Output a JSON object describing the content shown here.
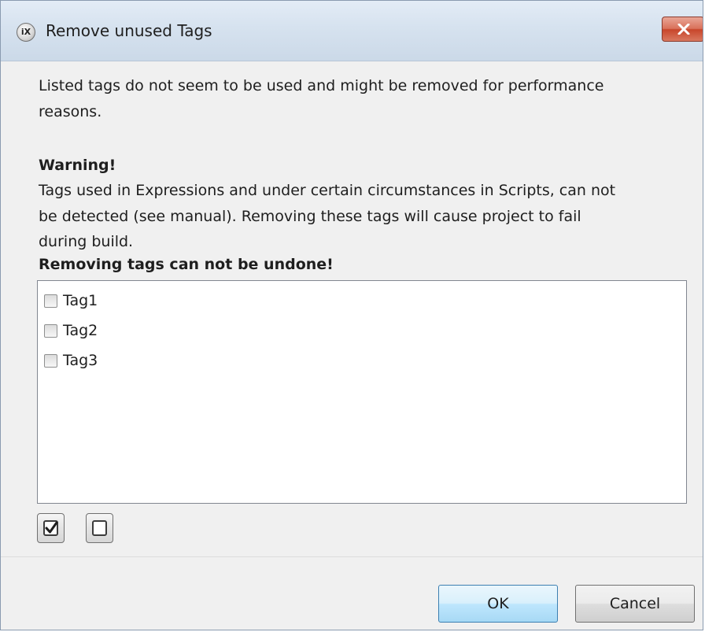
{
  "window": {
    "title": "Remove unused Tags",
    "icon_text": "iX"
  },
  "message": {
    "line1": "Listed tags do not seem to be used and might be removed for performance",
    "line2": "reasons."
  },
  "warning": {
    "heading": "Warning!",
    "line1": "Tags used in Expressions and under certain circumstances in Scripts, can not",
    "line2": "be detected (see manual). Removing these tags will cause project to fail",
    "line3": "during build.",
    "undo_notice": "Removing tags can not be undone!"
  },
  "tags": [
    {
      "label": "Tag1",
      "checked": false
    },
    {
      "label": "Tag2",
      "checked": false
    },
    {
      "label": "Tag3",
      "checked": false
    }
  ],
  "selection_buttons": {
    "select_all_icon": "checked-box-icon",
    "deselect_all_icon": "empty-box-icon"
  },
  "buttons": {
    "ok": "OK",
    "cancel": "Cancel"
  }
}
